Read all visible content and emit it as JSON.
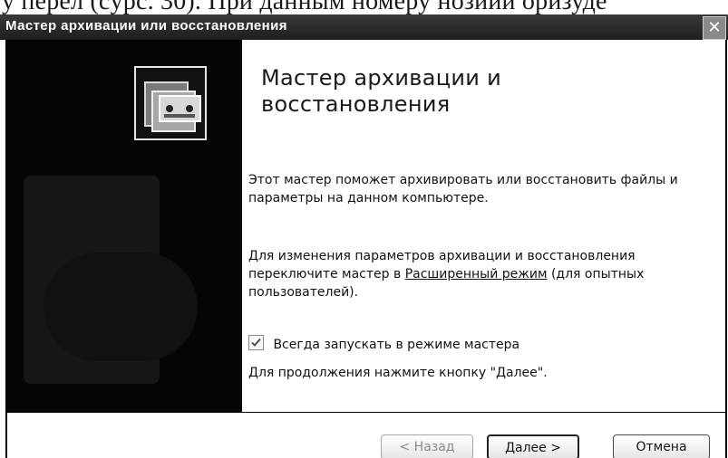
{
  "scan_header": {
    "text": "у перел (cуpс. 30). При данным номеру нозиии оризуде"
  },
  "window": {
    "title": "Мастер архивации или восстановления",
    "close_glyph": "✕"
  },
  "left_panel": {
    "icon": "backup-wizard-icon"
  },
  "content": {
    "heading": "Мастер архивации и восстановления",
    "para1": "Этот мастер поможет архивировать или восстановить файлы и параметры на данном компьютере.",
    "para2_before": "Для изменения параметров архивации и восстановления переключите мастер в ",
    "para2_link": "Расширенный режим",
    "para2_after": " (для опытных пользователей).",
    "checkbox_label": "Всегда запускать в режиме мастера",
    "checkbox_checked": true,
    "para3": "Для продолжения нажмите кнопку \"Далее\"."
  },
  "buttons": {
    "back": "< Назад",
    "next": "Далее >",
    "cancel": "Отмена"
  },
  "colors": {
    "titlebar": "#2a2a2a",
    "left_panel": "#050505",
    "text": "#111111",
    "disabled_text": "#8a8a8a"
  }
}
